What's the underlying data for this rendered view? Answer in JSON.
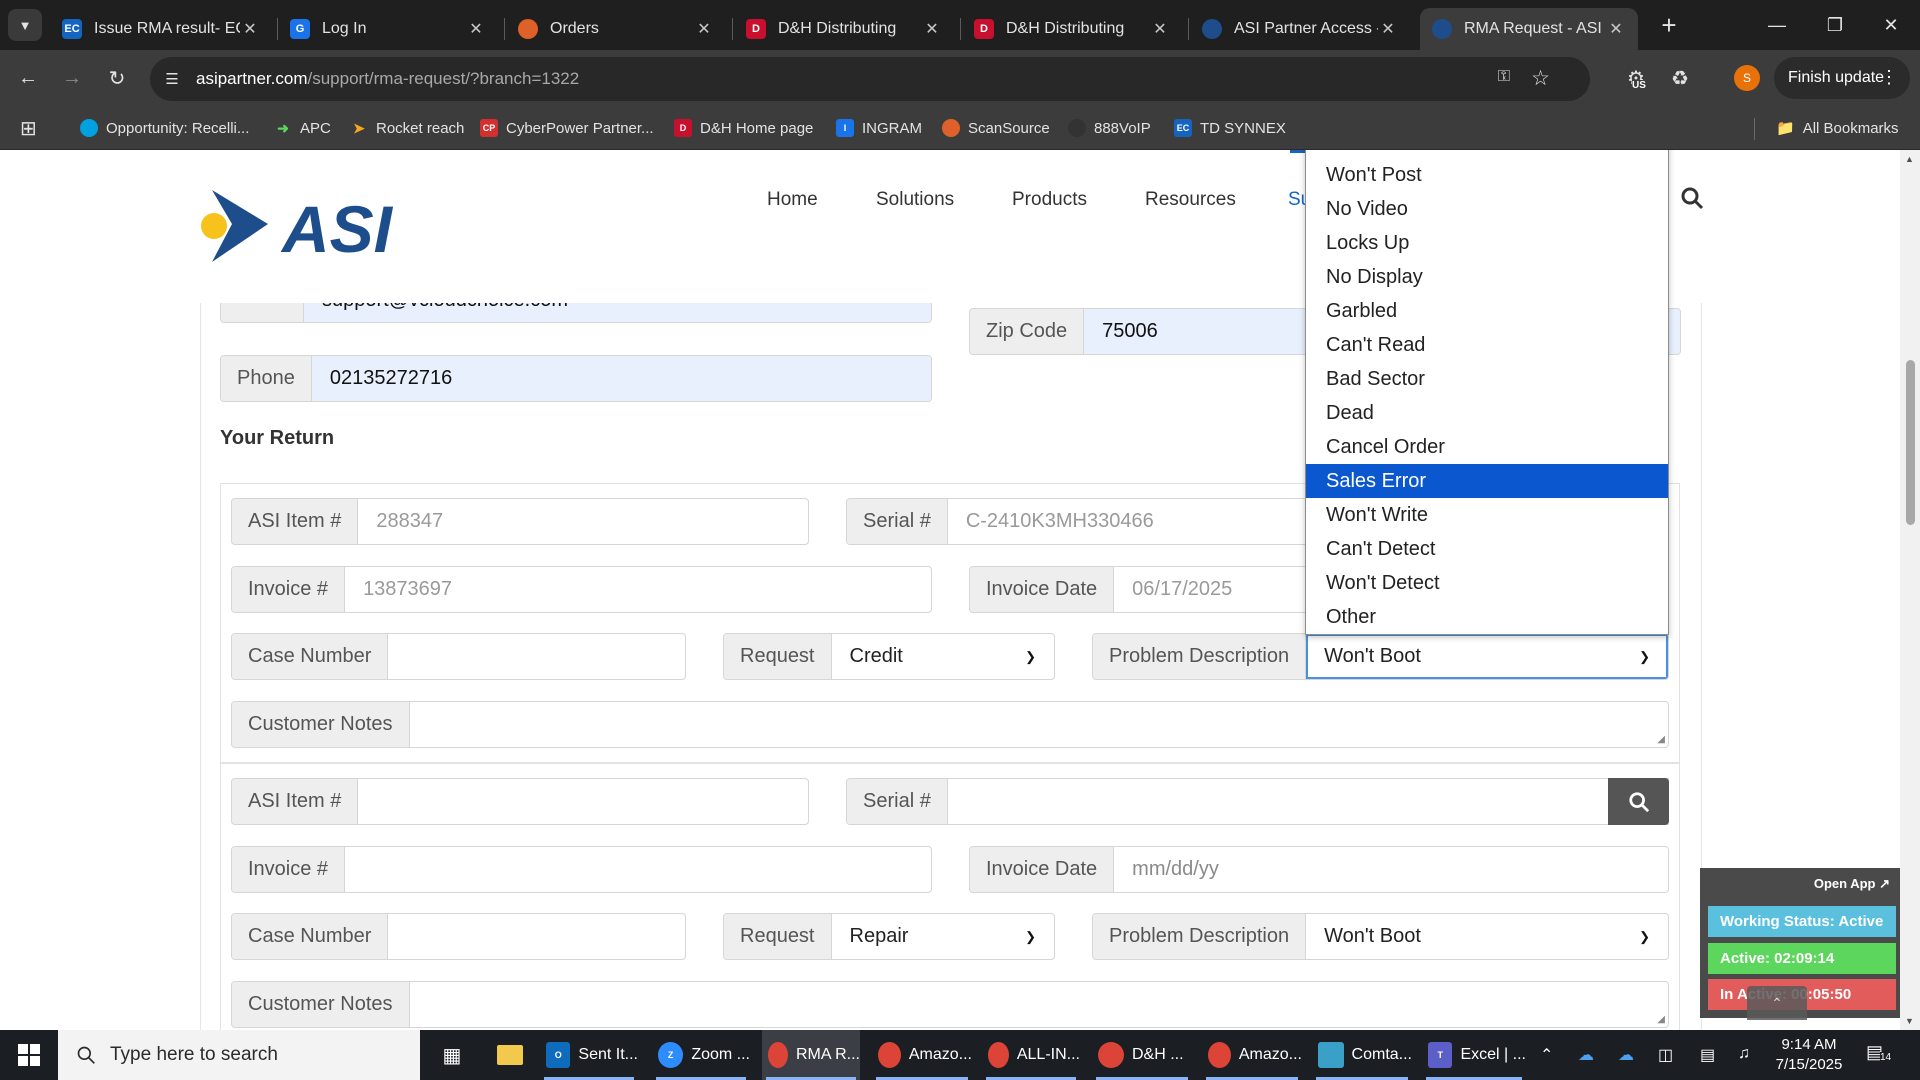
{
  "browser": {
    "tabs": [
      {
        "label": "Issue RMA result- EC",
        "icon": "ec-icon",
        "active": false
      },
      {
        "label": "Log In",
        "icon": "g-icon",
        "active": false
      },
      {
        "label": "Orders",
        "icon": "orders-icon",
        "active": false
      },
      {
        "label": "D&H Distributing",
        "icon": "dh-icon",
        "active": false
      },
      {
        "label": "D&H Distributing",
        "icon": "dh-icon",
        "active": false
      },
      {
        "label": "ASI Partner Access - ",
        "icon": "asi-icon",
        "active": false
      },
      {
        "label": "RMA Request - ASI P",
        "icon": "asi-icon",
        "active": true
      }
    ],
    "url_host": "asipartner.com",
    "url_path": "/support/rma-request/?branch=1322",
    "profile_initial": "S",
    "finish_update_label": "Finish update",
    "ext_badge": "US",
    "bookmarks": [
      {
        "label": "Opportunity: Recelli...",
        "icon": "salesforce-icon"
      },
      {
        "label": "APC",
        "icon": "apc-icon"
      },
      {
        "label": "Rocket reach",
        "icon": "rocket-icon"
      },
      {
        "label": "CyberPower Partner...",
        "icon": "cyberpower-icon"
      },
      {
        "label": "D&H Home page",
        "icon": "dh-icon"
      },
      {
        "label": "INGRAM",
        "icon": "ingram-icon"
      },
      {
        "label": "ScanSource",
        "icon": "scansource-icon"
      },
      {
        "label": "888VoIP",
        "icon": "voip-icon"
      },
      {
        "label": "TD SYNNEX",
        "icon": "ec-icon"
      }
    ],
    "all_bookmarks_label": "All Bookmarks"
  },
  "site": {
    "logo_text": "ASI",
    "nav": [
      "Home",
      "Solutions",
      "Products",
      "Resources",
      "Su"
    ]
  },
  "contact": {
    "email_label": "Email",
    "email_value": "support@vcloudchoice.com",
    "zip_label": "Zip Code",
    "zip_value": "75006",
    "phone_label": "Phone",
    "phone_value": "02135272716"
  },
  "return_heading": "Your Return",
  "items": [
    {
      "asi_item_label": "ASI Item #",
      "asi_item_value": "288347",
      "serial_label": "Serial #",
      "serial_value": "C-2410K3MH330466",
      "invoice_label": "Invoice #",
      "invoice_value": "13873697",
      "invoice_date_label": "Invoice Date",
      "invoice_date_value": "06/17/2025",
      "case_label": "Case Number",
      "case_value": "",
      "request_label": "Request",
      "request_value": "Credit",
      "problem_label": "Problem Description",
      "problem_value": "Won't Boot",
      "notes_label": "Customer Notes"
    },
    {
      "asi_item_label": "ASI Item #",
      "asi_item_value": "",
      "serial_label": "Serial #",
      "serial_value": "",
      "invoice_label": "Invoice #",
      "invoice_value": "",
      "invoice_date_label": "Invoice Date",
      "invoice_date_placeholder": "mm/dd/yy",
      "case_label": "Case Number",
      "case_value": "",
      "request_label": "Request",
      "request_value": "Repair",
      "problem_label": "Problem Description",
      "problem_value": "Won't Boot",
      "notes_label": "Customer Notes"
    }
  ],
  "problem_dropdown": {
    "options": [
      "Won't Boot",
      "Won't Post",
      "No Video",
      "Locks Up",
      "No Display",
      "Garbled",
      "Can't Read",
      "Bad Sector",
      "Dead",
      "Cancel Order",
      "Sales Error",
      "Won't Write",
      "Can't Detect",
      "Won't Detect",
      "Other"
    ],
    "highlighted": "Sales Error"
  },
  "status_widget": {
    "open_app": "Open App ↗",
    "working_status": "Working Status: Active",
    "active": "Active: 02:09:14",
    "inactive": "In Active: 00:05:50"
  },
  "taskbar": {
    "search_placeholder": "Type here to search",
    "tasks": [
      {
        "label": "Sent It...",
        "icon": "outlook-icon"
      },
      {
        "label": "Zoom ...",
        "icon": "zoom-icon"
      },
      {
        "label": "RMA R...",
        "icon": "chrome-icon"
      },
      {
        "label": "Amazo...",
        "icon": "chrome-icon"
      },
      {
        "label": "ALL-IN...",
        "icon": "chrome-icon"
      },
      {
        "label": "D&H ...",
        "icon": "chrome-icon"
      },
      {
        "label": "Amazo...",
        "icon": "chrome-icon"
      },
      {
        "label": "Comta...",
        "icon": "comtacts-icon"
      },
      {
        "label": "Excel | ...",
        "icon": "teams-icon"
      }
    ],
    "time": "9:14 AM",
    "date": "7/15/2025",
    "notifications": "14"
  },
  "colors": {
    "accent_blue": "#0b57d0",
    "logo_blue": "#1e4d8c",
    "logo_yellow": "#f6c21b",
    "filled_input": "#e8f0fe",
    "status_active": "#5bc0de",
    "status_green": "#5cd65c",
    "status_red": "#e25c5c"
  }
}
